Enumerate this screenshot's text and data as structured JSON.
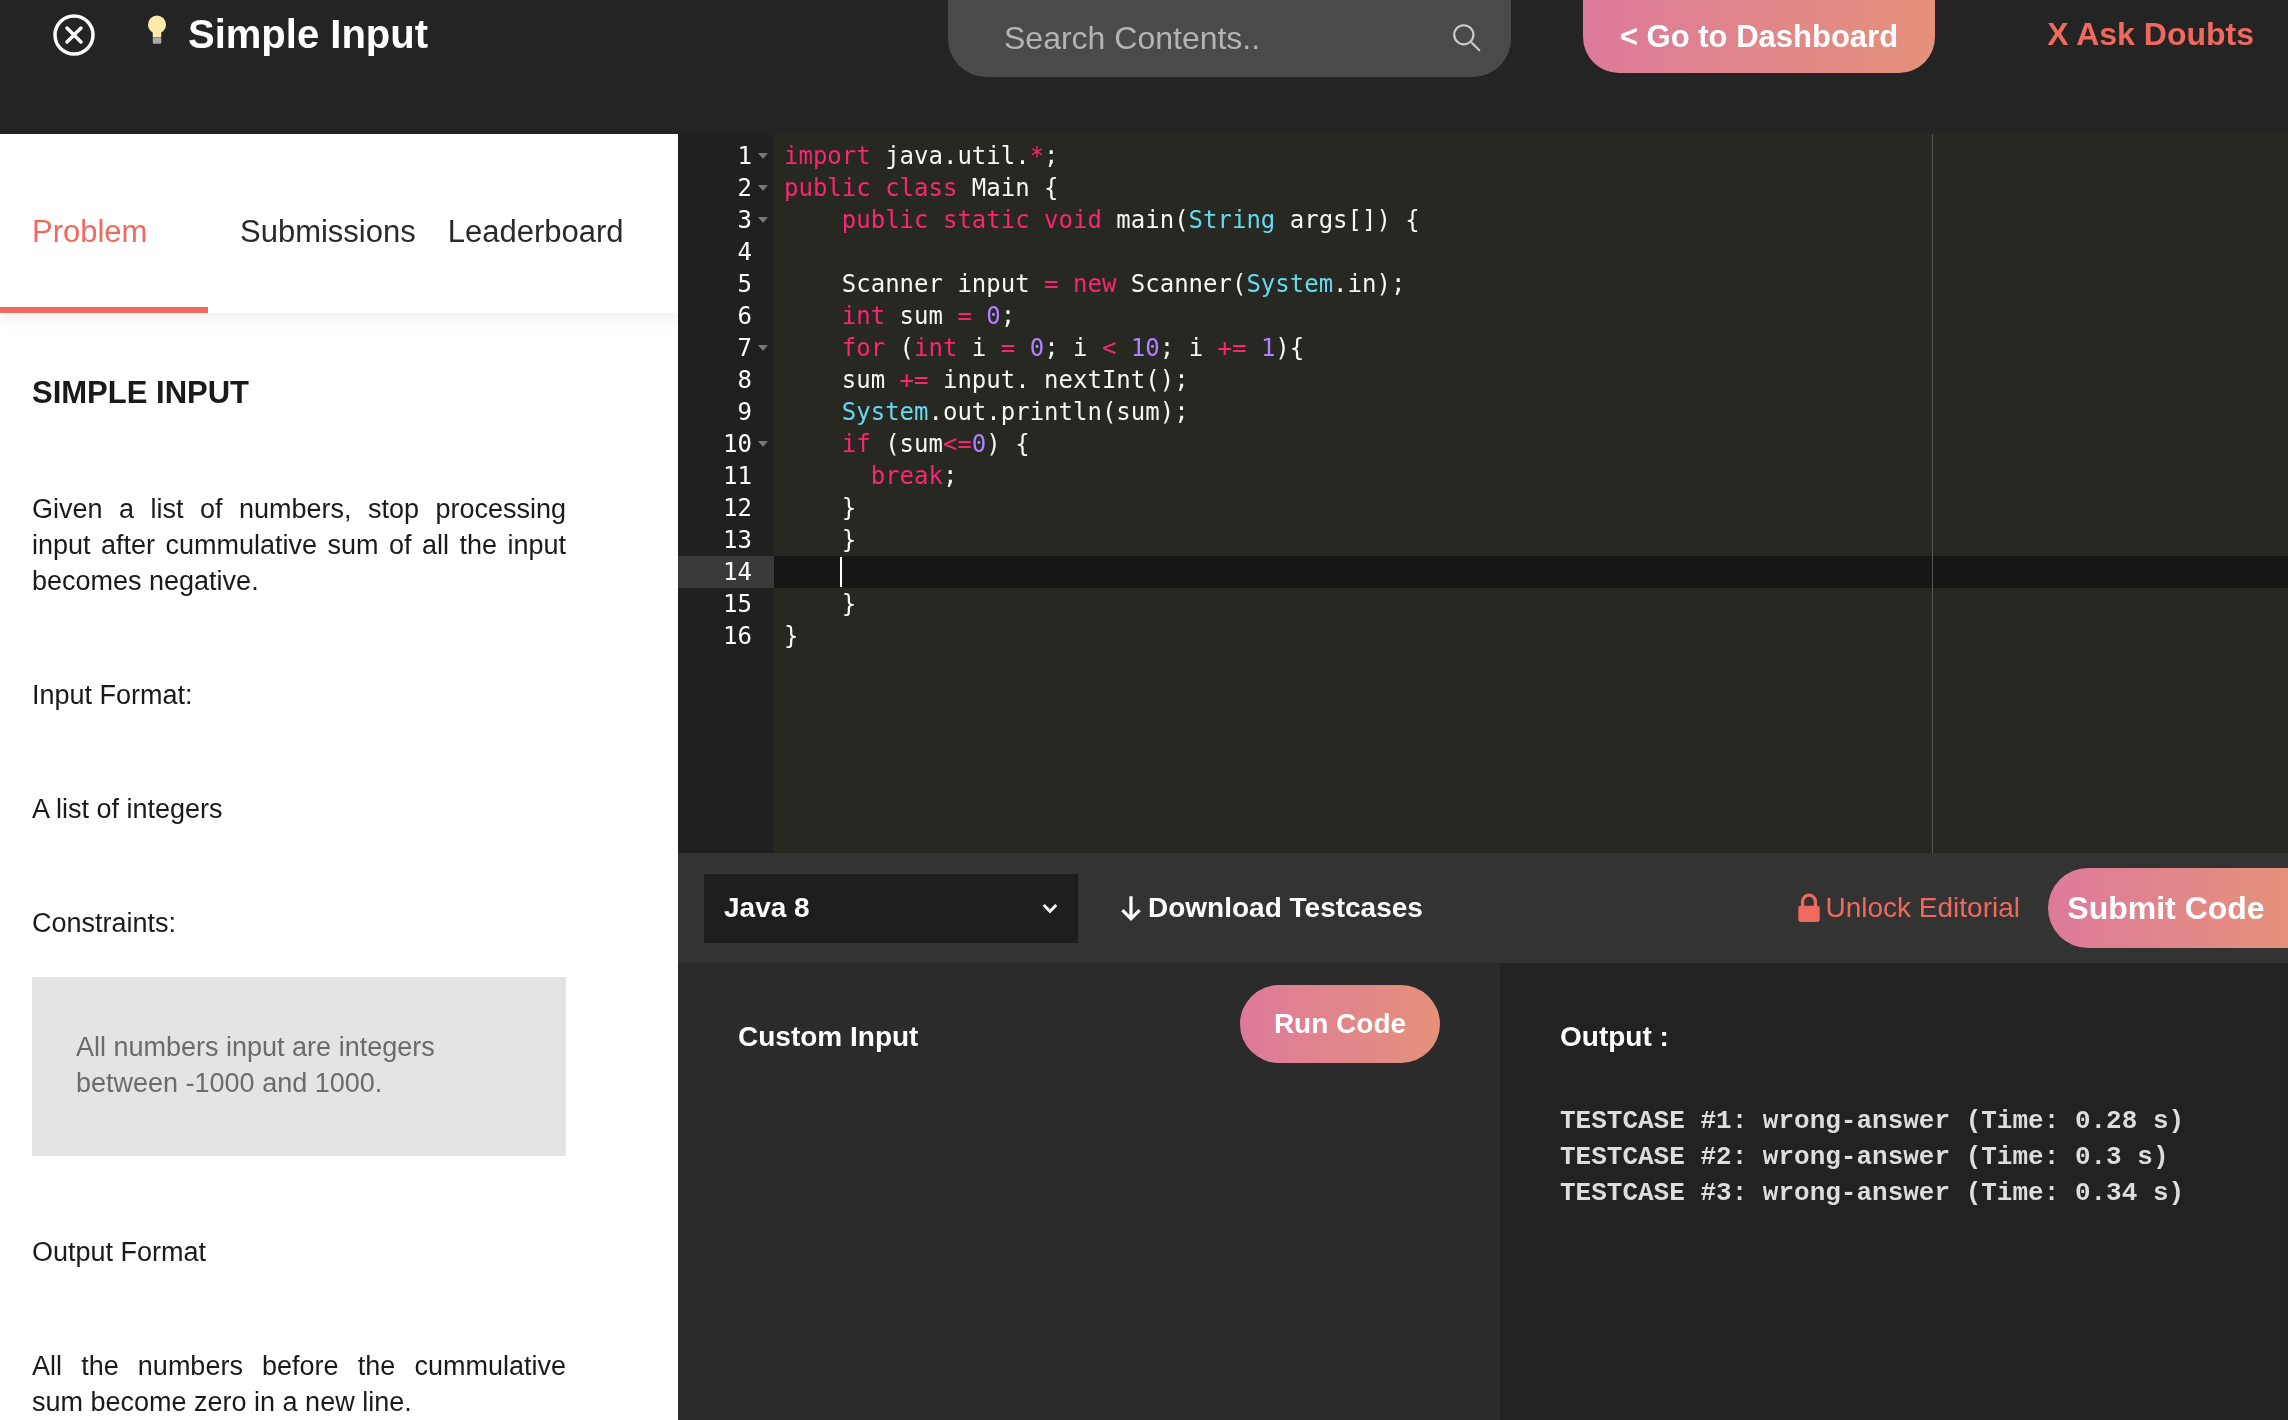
{
  "header": {
    "title": "Simple Input",
    "search": {
      "placeholder": "Search Contents.."
    },
    "dashboard_button": "< Go to Dashboard",
    "ask_doubts_link": "X Ask Doubts"
  },
  "tabs": [
    {
      "label": "Problem",
      "selected": true
    },
    {
      "label": "Submissions",
      "selected": false
    },
    {
      "label": "Leaderboard",
      "selected": false
    }
  ],
  "problem": {
    "heading": "SIMPLE INPUT",
    "description": "Given a list of numbers, stop processing input after cummulative sum of all the input becomes negative.",
    "input_format_label": "Input Format:",
    "input_format": "A list of integers",
    "constraints_label": "Constraints:",
    "constraints": "All numbers input are integers between -1000 and 1000.",
    "output_format_label": "Output Format",
    "output_format": "All the numbers before the cummulative sum become zero in a new line."
  },
  "editor": {
    "lines": [
      {
        "number": "1",
        "fold": true,
        "current": false,
        "tokens": [
          {
            "kind": "keyword",
            "text": "import"
          },
          {
            "kind": "plain",
            "text": " java.util."
          },
          {
            "kind": "keyword",
            "text": "*"
          },
          {
            "kind": "plain",
            "text": ";"
          }
        ]
      },
      {
        "number": "2",
        "fold": true,
        "current": false,
        "tokens": [
          {
            "kind": "keyword",
            "text": "public class"
          },
          {
            "kind": "plain",
            "text": " Main {"
          }
        ]
      },
      {
        "number": "3",
        "fold": true,
        "current": false,
        "tokens": [
          {
            "kind": "keyword",
            "text": "    public static void"
          },
          {
            "kind": "plain",
            "text": " main("
          },
          {
            "kind": "type",
            "text": "String"
          },
          {
            "kind": "plain",
            "text": " args[]) {"
          }
        ]
      },
      {
        "number": "4",
        "fold": false,
        "current": false
      },
      {
        "number": "5",
        "fold": false,
        "current": false,
        "tokens": [
          {
            "kind": "plain",
            "text": "    Scanner input "
          },
          {
            "kind": "keyword",
            "text": "="
          },
          {
            "kind": "keyword",
            "text": " new"
          },
          {
            "kind": "plain",
            "text": " Scanner("
          },
          {
            "kind": "type",
            "text": "System"
          },
          {
            "kind": "plain",
            "text": ".in);"
          }
        ]
      },
      {
        "number": "6",
        "fold": false,
        "current": false,
        "tokens": [
          {
            "kind": "keyword",
            "text": "    int"
          },
          {
            "kind": "plain",
            "text": " sum "
          },
          {
            "kind": "keyword",
            "text": "="
          },
          {
            "kind": "number",
            "text": " 0"
          },
          {
            "kind": "plain",
            "text": ";"
          }
        ]
      },
      {
        "number": "7",
        "fold": true,
        "current": false,
        "tokens": [
          {
            "kind": "keyword",
            "text": "    for"
          },
          {
            "kind": "plain",
            "text": " ("
          },
          {
            "kind": "keyword",
            "text": "int"
          },
          {
            "kind": "plain",
            "text": " i "
          },
          {
            "kind": "keyword",
            "text": "="
          },
          {
            "kind": "number",
            "text": " 0"
          },
          {
            "kind": "plain",
            "text": "; i "
          },
          {
            "kind": "keyword",
            "text": "<"
          },
          {
            "kind": "number",
            "text": " 10"
          },
          {
            "kind": "plain",
            "text": "; i "
          },
          {
            "kind": "keyword",
            "text": "+="
          },
          {
            "kind": "number",
            "text": " 1"
          },
          {
            "kind": "plain",
            "text": "){"
          }
        ]
      },
      {
        "number": "8",
        "fold": false,
        "current": false,
        "tokens": [
          {
            "kind": "plain",
            "text": "    sum "
          },
          {
            "kind": "keyword",
            "text": "+="
          },
          {
            "kind": "plain",
            "text": " input. nextInt();"
          }
        ]
      },
      {
        "number": "9",
        "fold": false,
        "current": false,
        "tokens": [
          {
            "kind": "type",
            "text": "    System"
          },
          {
            "kind": "plain",
            "text": ".out.println(sum);"
          }
        ]
      },
      {
        "number": "10",
        "fold": true,
        "current": false,
        "tokens": [
          {
            "kind": "keyword",
            "text": "    if"
          },
          {
            "kind": "plain",
            "text": " (sum"
          },
          {
            "kind": "keyword",
            "text": "<="
          },
          {
            "kind": "number",
            "text": "0"
          },
          {
            "kind": "plain",
            "text": ") {"
          }
        ]
      },
      {
        "number": "11",
        "fold": false,
        "current": false,
        "tokens": [
          {
            "kind": "keyword",
            "text": "      break"
          },
          {
            "kind": "plain",
            "text": ";"
          }
        ]
      },
      {
        "number": "12",
        "fold": false,
        "current": false,
        "tokens": [
          {
            "kind": "plain",
            "text": "    }"
          }
        ]
      },
      {
        "number": "13",
        "fold": false,
        "current": false,
        "tokens": [
          {
            "kind": "plain",
            "text": "    }"
          }
        ]
      },
      {
        "number": "14",
        "fold": false,
        "current": true
      },
      {
        "number": "15",
        "fold": false,
        "current": false,
        "tokens": [
          {
            "kind": "plain",
            "text": "    }"
          }
        ]
      },
      {
        "number": "16",
        "fold": false,
        "current": false,
        "tokens": [
          {
            "kind": "plain",
            "text": "}"
          }
        ]
      }
    ]
  },
  "toolbar": {
    "language": "Java 8",
    "download_link": "Download Testcases",
    "unlock_link": "Unlock Editorial",
    "submit_button": "Submit Code"
  },
  "custom_input": {
    "label": "Custom Input",
    "run_button": "Run Code"
  },
  "output": {
    "label": "Output :",
    "results": [
      "TESTCASE #1: wrong-answer (Time: 0.28 s)",
      "TESTCASE #2: wrong-answer (Time: 0.3 s)",
      "TESTCASE #3: wrong-answer (Time: 0.34 s)"
    ]
  }
}
